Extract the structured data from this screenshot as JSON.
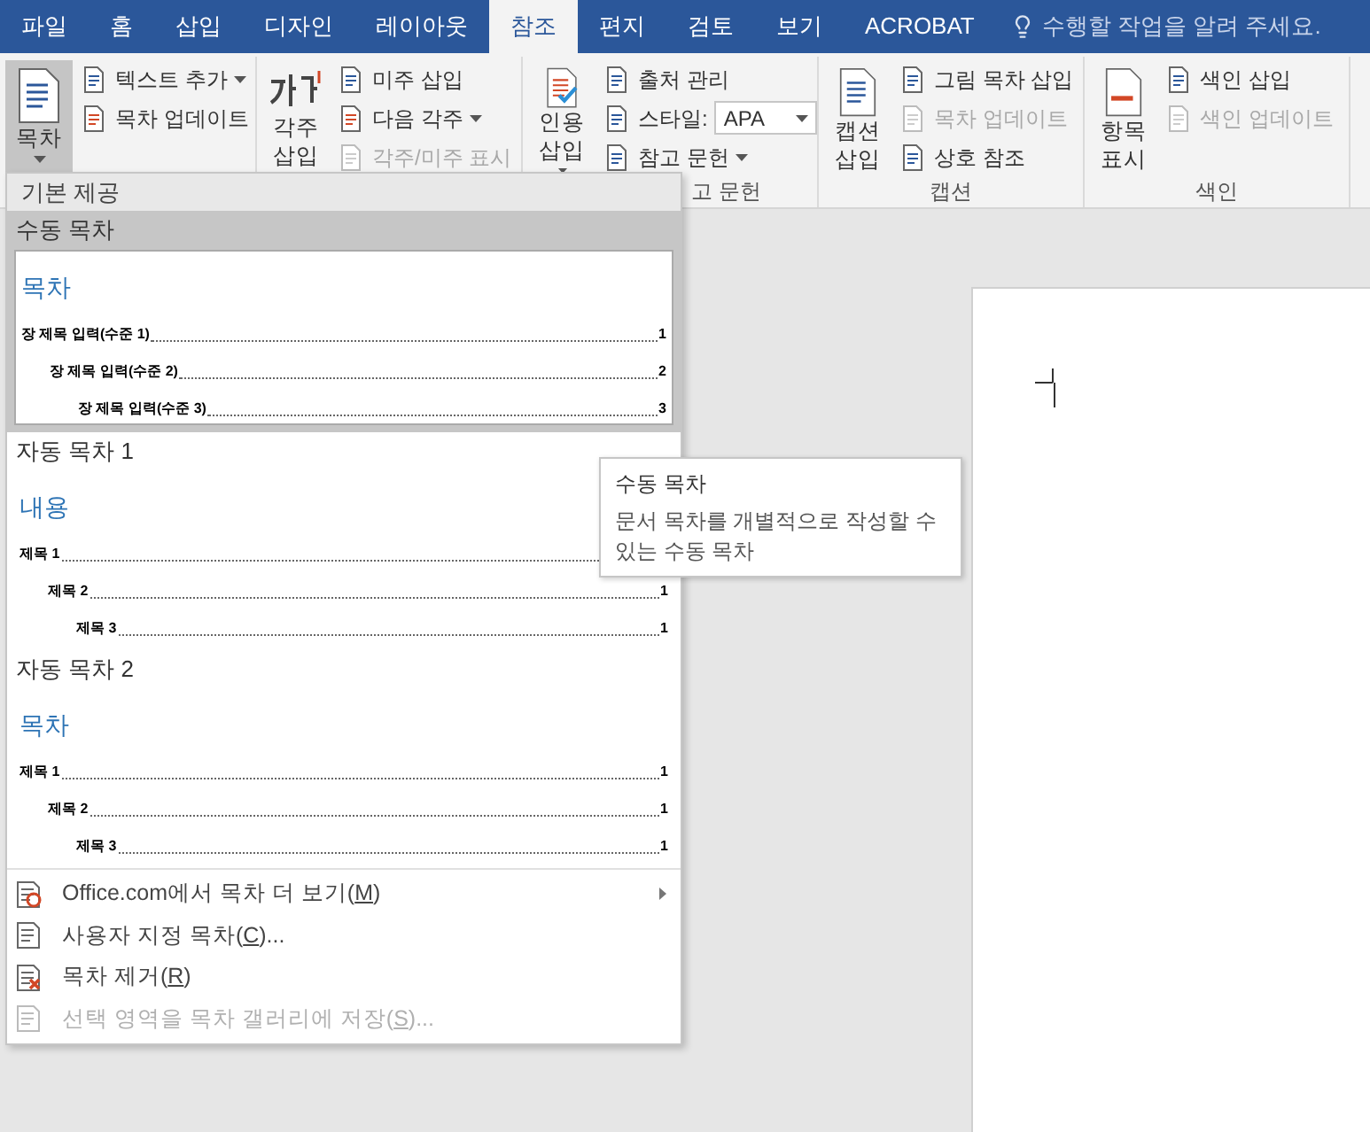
{
  "tabs": [
    {
      "label": "파일",
      "selected": false
    },
    {
      "label": "홈",
      "selected": false
    },
    {
      "label": "삽입",
      "selected": false
    },
    {
      "label": "디자인",
      "selected": false
    },
    {
      "label": "레이아웃",
      "selected": false
    },
    {
      "label": "참조",
      "selected": true
    },
    {
      "label": "편지",
      "selected": false
    },
    {
      "label": "검토",
      "selected": false
    },
    {
      "label": "보기",
      "selected": false
    },
    {
      "label": "ACROBAT",
      "selected": false
    }
  ],
  "tell_me": {
    "placeholder": "수행할 작업을 알려 주세요."
  },
  "ribbon_groups": [
    {
      "large": {
        "label": "목차",
        "caret": true,
        "pressed": true
      },
      "small": [
        {
          "kind": "button",
          "label": "텍스트 추가",
          "caret": true,
          "disabled": false
        },
        {
          "kind": "button",
          "label": "목차 업데이트",
          "caret": false,
          "disabled": false
        }
      ]
    },
    {
      "large": {
        "label": "각주 삽입",
        "caret": false,
        "pressed": false
      },
      "small": [
        {
          "kind": "button",
          "label": "미주 삽입",
          "caret": false,
          "disabled": false
        },
        {
          "kind": "button",
          "label": "다음 각주",
          "caret": true,
          "disabled": false
        },
        {
          "kind": "button",
          "label": "각주/미주 표시",
          "caret": false,
          "disabled": true
        }
      ]
    },
    {
      "label": "고 문헌",
      "large": {
        "label": "인용 삽입",
        "caret": true,
        "pressed": false
      },
      "small": [
        {
          "kind": "button",
          "label": "출처 관리",
          "caret": false,
          "disabled": false
        },
        {
          "kind": "combo",
          "label": "스타일:",
          "value": "APA"
        },
        {
          "kind": "button",
          "label": "참고 문헌",
          "caret": true,
          "disabled": false
        }
      ]
    },
    {
      "label": "캡션",
      "large": {
        "label": "캡션 삽입",
        "caret": false,
        "pressed": false
      },
      "small": [
        {
          "kind": "button",
          "label": "그림 목차 삽입",
          "caret": false,
          "disabled": false
        },
        {
          "kind": "button",
          "label": "목차 업데이트",
          "caret": false,
          "disabled": true
        },
        {
          "kind": "button",
          "label": "상호 참조",
          "caret": false,
          "disabled": false
        }
      ]
    },
    {
      "label": "색인",
      "large": {
        "label": "항목 표시",
        "caret": false,
        "pressed": false
      },
      "small": [
        {
          "kind": "button",
          "label": "색인 삽입",
          "caret": false,
          "disabled": false
        },
        {
          "kind": "button",
          "label": "색인 업데이트",
          "caret": false,
          "disabled": true
        }
      ]
    }
  ],
  "gallery": {
    "header": "기본 제공",
    "items": [
      {
        "title": "수동 목차",
        "selected": true,
        "heading": "목차",
        "entries": [
          {
            "text": "장 제목 입력(수준 1)",
            "page": "1",
            "children": [
              {
                "text": "장 제목 입력(수준 2)",
                "page": "2",
                "children": [
                  {
                    "text": "장 제목 입력(수준 3)",
                    "page": "3"
                  }
                ]
              }
            ]
          }
        ]
      },
      {
        "title": "자동 목차 1",
        "selected": false,
        "heading": "내용",
        "entries": [
          {
            "text": "제목 1",
            "children": [
              {
                "text": "제목 2",
                "page": "1",
                "children": [
                  {
                    "text": "제목 3",
                    "page": "1"
                  }
                ]
              }
            ]
          }
        ]
      },
      {
        "title": "자동 목차 2",
        "selected": false,
        "heading": "목차",
        "entries": [
          {
            "text": "제목 1",
            "page": "1",
            "children": [
              {
                "text": "제목 2",
                "page": "1",
                "children": [
                  {
                    "text": "제목 3",
                    "page": "1"
                  }
                ]
              }
            ]
          }
        ]
      }
    ]
  },
  "menu_items": [
    {
      "label": "Office.com에서 목차 더 보기(",
      "key": "M",
      "rest": ")",
      "submenu": true,
      "disabled": false
    },
    {
      "label": "사용자 지정 목차(",
      "key": "C",
      "rest": ")...",
      "submenu": false,
      "disabled": false
    },
    {
      "label": "목차 제거(",
      "key": "R",
      "rest": ")",
      "submenu": false,
      "disabled": false
    },
    {
      "label": "선택 영역을 목차 갤러리에 저장(",
      "key": "S",
      "rest": ")...",
      "submenu": false,
      "disabled": true
    }
  ],
  "tooltip": {
    "title": "수동 목차",
    "description": "문서 목차를 개별적으로 작성할 수 있는 수동 목차"
  }
}
